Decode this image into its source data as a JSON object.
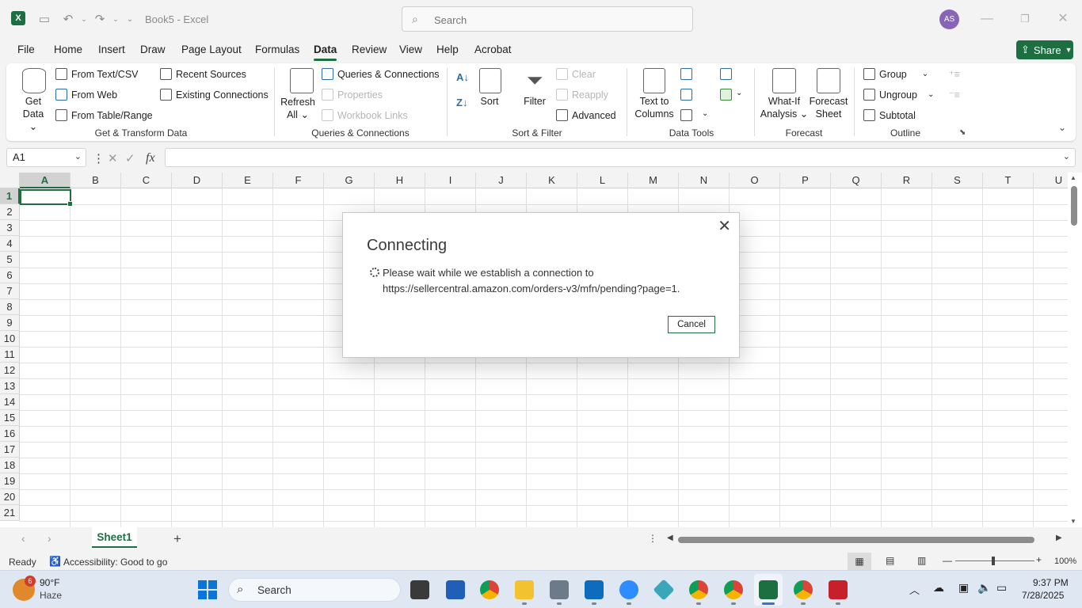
{
  "window": {
    "doc_title": "Book5 - Excel",
    "app_icon_letter": "X"
  },
  "search": {
    "placeholder": "Search"
  },
  "user": {
    "initials": "AS"
  },
  "menu": {
    "tabs": [
      "File",
      "Home",
      "Insert",
      "Draw",
      "Page Layout",
      "Formulas",
      "Data",
      "Review",
      "View",
      "Help",
      "Acrobat"
    ],
    "active": "Data"
  },
  "share": {
    "label": "Share"
  },
  "ribbon": {
    "get_transform": {
      "get_data_l1": "Get",
      "get_data_l2": "Data",
      "from_text_csv": "From Text/CSV",
      "from_web": "From Web",
      "from_table_range": "From Table/Range",
      "recent_sources": "Recent Sources",
      "existing_connections": "Existing Connections",
      "group_label": "Get & Transform Data"
    },
    "queries": {
      "refresh_l1": "Refresh",
      "refresh_l2": "All",
      "queries_connections": "Queries & Connections",
      "properties": "Properties",
      "workbook_links": "Workbook Links",
      "group_label": "Queries & Connections"
    },
    "sort_filter": {
      "sort": "Sort",
      "filter": "Filter",
      "clear": "Clear",
      "reapply": "Reapply",
      "advanced": "Advanced",
      "group_label": "Sort & Filter"
    },
    "data_tools": {
      "text_to_columns_l1": "Text to",
      "text_to_columns_l2": "Columns",
      "group_label": "Data Tools"
    },
    "forecast": {
      "what_if_l1": "What-If",
      "what_if_l2": "Analysis",
      "forecast_sheet_l1": "Forecast",
      "forecast_sheet_l2": "Sheet",
      "group_label": "Forecast"
    },
    "outline": {
      "group": "Group",
      "ungroup": "Ungroup",
      "subtotal": "Subtotal",
      "group_label": "Outline"
    }
  },
  "formula_bar": {
    "name_box": "A1",
    "fx": "fx",
    "value": ""
  },
  "grid": {
    "columns": [
      "A",
      "B",
      "C",
      "D",
      "E",
      "F",
      "G",
      "H",
      "I",
      "J",
      "K",
      "L",
      "M",
      "N",
      "O",
      "P",
      "Q",
      "R",
      "S",
      "T",
      "U"
    ],
    "rows": [
      "1",
      "2",
      "3",
      "4",
      "5",
      "6",
      "7",
      "8",
      "9",
      "10",
      "11",
      "12",
      "13",
      "14",
      "15",
      "16",
      "17",
      "18",
      "19",
      "20",
      "21"
    ],
    "selected_cell": "A1"
  },
  "sheets": {
    "tabs": [
      "Sheet1"
    ],
    "add": "+"
  },
  "status": {
    "ready": "Ready",
    "accessibility": "Accessibility: Good to go",
    "zoom": "100%"
  },
  "dialog": {
    "title": "Connecting",
    "message_line1": "Please wait while we establish a connection to",
    "message_line2": "https://sellercentral.amazon.com/orders-v3/mfn/pending?page=1.",
    "cancel": "Cancel",
    "close": "✕"
  },
  "taskbar": {
    "weather_temp": "90°F",
    "weather_desc": "Haze",
    "weather_badge": "6",
    "search_label": "Search",
    "time": "9:37 PM",
    "date": "7/28/2025"
  },
  "colors": {
    "accent": "#1d6f42",
    "avatar": "#8764b8"
  }
}
